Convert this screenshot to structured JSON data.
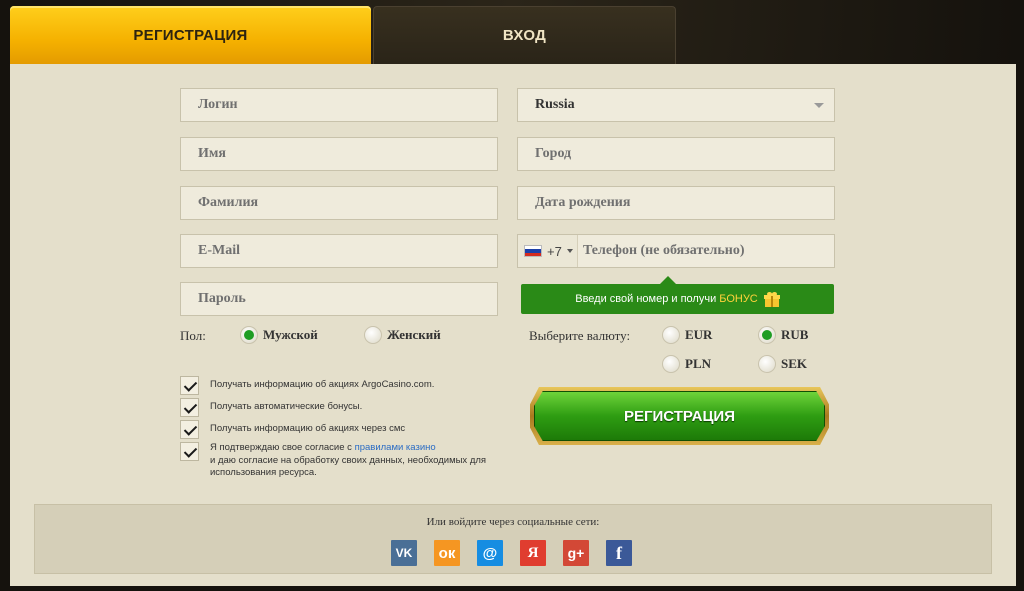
{
  "tabs": {
    "register": "РЕГИСТРАЦИЯ",
    "login": "ВХОД"
  },
  "fields": {
    "login_placeholder": "Логин",
    "name_placeholder": "Имя",
    "surname_placeholder": "Фамилия",
    "email_placeholder": "E-Mail",
    "password_placeholder": "Пароль",
    "country_value": "Russia",
    "city_placeholder": "Город",
    "birthdate_placeholder": "Дата рождения",
    "phone_code": "+7",
    "phone_placeholder": "Телефон (не обязательно)"
  },
  "bonus": {
    "text": "Введи свой номер и получи",
    "highlight": "БОНУС",
    "icon": "gift-icon"
  },
  "gender": {
    "label": "Пол:",
    "male": "Мужской",
    "female": "Женский",
    "selected": "male"
  },
  "currency": {
    "label": "Выберите валюту:",
    "options": [
      "EUR",
      "RUB",
      "PLN",
      "SEK"
    ],
    "selected": "RUB"
  },
  "checkboxes": {
    "promo": "Получать информацию об акциях ArgoCasino.com.",
    "auto_bonus": "Получать автоматические бонусы.",
    "sms": "Получать информацию об акциях через смс",
    "consent_before": "Я подтверждаю свое согласие с",
    "consent_link": "правилами казино",
    "consent_after": "и даю согласие на обработку своих данных, необходимых для использования ресурса."
  },
  "register_button": "РЕГИСТРАЦИЯ",
  "social": {
    "title": "Или войдите через социальные сети:",
    "icons": [
      {
        "name": "vk-icon",
        "glyph": "VK",
        "color": "#4a6f96"
      },
      {
        "name": "odnoklassniki-icon",
        "glyph": "ок",
        "color": "#f59622"
      },
      {
        "name": "mailru-icon",
        "glyph": "@",
        "color": "#168de2"
      },
      {
        "name": "yandex-icon",
        "glyph": "Я",
        "color": "#e03d2f"
      },
      {
        "name": "google-plus-icon",
        "glyph": "g+",
        "color": "#d34836"
      },
      {
        "name": "facebook-icon",
        "glyph": "f",
        "color": "#3b5998"
      }
    ]
  }
}
